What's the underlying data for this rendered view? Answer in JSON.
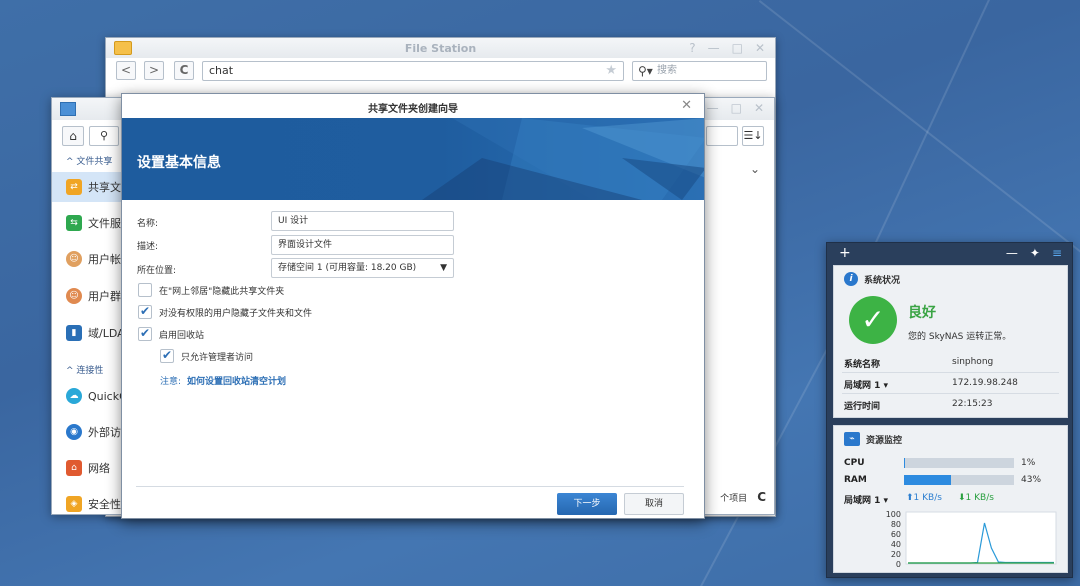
{
  "file_station": {
    "title": "File Station",
    "window_buttons": [
      "?",
      "—",
      "□",
      "✕"
    ],
    "back": "<",
    "forward": ">",
    "refresh": "C",
    "path": "chat",
    "search_placeholder": "搜索"
  },
  "control_panel": {
    "sections": [
      {
        "label": "文件共享"
      },
      {
        "label": "连接性"
      }
    ],
    "items": [
      {
        "label": "共享文件夹",
        "color": "#f0a524"
      },
      {
        "label": "文件服务",
        "color": "#2ea84f"
      },
      {
        "label": "用户帐号",
        "color": "#e0a060"
      },
      {
        "label": "用户群组",
        "color": "#e08a50"
      },
      {
        "label": "域/LDAP",
        "color": "#2a6fb6"
      },
      {
        "label": "QuickConnect",
        "color": "#2aa8d8"
      },
      {
        "label": "外部访问",
        "color": "#2a78cc"
      },
      {
        "label": "网络",
        "color": "#e05a30"
      },
      {
        "label": "安全性",
        "color": "#f0a524"
      }
    ],
    "bottom_text": "个项目",
    "bottom_refresh": "C"
  },
  "wizard": {
    "title": "共享文件夹创建向导",
    "close": "✕",
    "header": "设置基本信息",
    "name_label": "名称:",
    "name_value": "UI 设计",
    "desc_label": "描述:",
    "desc_value": "界面设计文件",
    "location_label": "所在位置:",
    "location_value": "存储空间 1 (可用容量:  18.20 GB)",
    "options": [
      {
        "label": "在\"网上邻居\"隐藏此共享文件夹",
        "checked": false
      },
      {
        "label": "对没有权限的用户隐藏子文件夹和文件",
        "checked": true
      },
      {
        "label": "启用回收站",
        "checked": true
      },
      {
        "label": "只允许管理者访问",
        "checked": true
      }
    ],
    "note_prefix": "注意:",
    "note_link": "如何设置回收站清空计划",
    "next_button": "下一步",
    "cancel_button": "取消"
  },
  "widgets": {
    "add": "+",
    "controls": [
      "—",
      "📌",
      "≡"
    ],
    "system": {
      "title": "系统状况",
      "status": "良好",
      "message": "您的 SkyNAS 运转正常。",
      "rows": [
        {
          "key": "系统名称",
          "value": "sinphong"
        },
        {
          "key": "局域网 1 ▾",
          "value": "172.19.98.248"
        },
        {
          "key": "运行时间",
          "value": "22:15:23"
        }
      ]
    },
    "resource": {
      "title": "资源监控",
      "cpu_label": "CPU",
      "cpu_pct": "1%",
      "cpu_value": 1,
      "ram_label": "RAM",
      "ram_pct": "43%",
      "ram_value": 43,
      "lan_label": "局域网 1 ▾",
      "upload": "1 KB/s",
      "download": "1 KB/s",
      "chart_ticks": [
        "100",
        "80",
        "60",
        "40",
        "20",
        "0"
      ],
      "series_up": [
        0,
        0,
        0,
        0,
        0,
        0,
        0,
        0,
        0,
        0,
        0,
        0,
        0,
        0,
        0,
        0,
        0,
        0,
        0,
        0,
        0,
        0
      ],
      "series_down": [
        0,
        0,
        0,
        0,
        0,
        0,
        0,
        0,
        0,
        0,
        1,
        80,
        30,
        2,
        1,
        1,
        1,
        1,
        1,
        1,
        1,
        1
      ]
    }
  }
}
